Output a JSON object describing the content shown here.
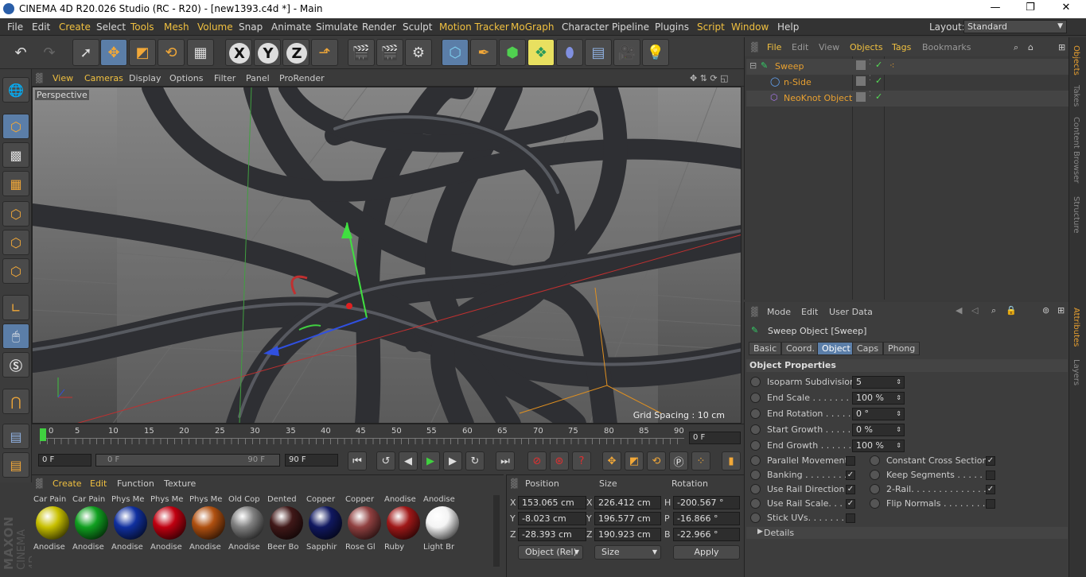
{
  "window": {
    "title": "CINEMA 4D R20.026 Studio (RC - R20) - [new1393.c4d *] - Main",
    "min": "—",
    "max": "❐",
    "close": "✕"
  },
  "menu": [
    "File",
    "Edit",
    "Create",
    "Select",
    "Tools",
    "Mesh",
    "Volume",
    "Snap",
    "Animate",
    "Simulate",
    "Render",
    "Sculpt",
    "Motion Tracker",
    "MoGraph",
    "Character",
    "Pipeline",
    "Plugins",
    "Script",
    "Window",
    "Help"
  ],
  "layout": {
    "label": "Layout:",
    "value": "Standard"
  },
  "toolbar_icons": [
    "undo-icon",
    "redo-icon",
    "select-cursor-icon",
    "move-icon",
    "scale-icon",
    "rotate-icon",
    "render-region-icon",
    "x-axis-icon",
    "y-axis-icon",
    "z-axis-icon",
    "coordinate-system-icon",
    "render-view-icon",
    "render-picture-viewer-icon",
    "edit-render-settings-icon",
    "cube-icon",
    "pen-spline-icon",
    "subdivision-icon",
    "array-icon",
    "deformer-icon",
    "floor-icon",
    "camera-icon",
    "light-icon"
  ],
  "viewport": {
    "menu": [
      "View",
      "Cameras",
      "Display",
      "Options",
      "Filter",
      "Panel",
      "ProRender"
    ],
    "label": "Perspective",
    "grid": "Grid Spacing : 10 cm"
  },
  "timeline": {
    "ticks": [
      "0",
      "5",
      "10",
      "15",
      "20",
      "25",
      "30",
      "35",
      "40",
      "45",
      "50",
      "55",
      "60",
      "65",
      "70",
      "75",
      "80",
      "85",
      "90"
    ],
    "frame": "0 F"
  },
  "playback": {
    "start": "0 F",
    "cur": "0 F",
    "end1": "90 F",
    "end2": "90 F"
  },
  "materials": {
    "tabs": [
      "Create",
      "Edit",
      "Function",
      "Texture"
    ],
    "items": [
      {
        "top": "Car Pain",
        "bottom": "Anodise",
        "color": "#c8c000"
      },
      {
        "top": "Car Pain",
        "bottom": "Anodise",
        "color": "#10a020"
      },
      {
        "top": "Phys Me",
        "bottom": "Anodise",
        "color": "#1030a0"
      },
      {
        "top": "Phys Me",
        "bottom": "Anodise",
        "color": "#c00010"
      },
      {
        "top": "Phys Me",
        "bottom": "Anodise",
        "color": "#b05010"
      },
      {
        "top": "Old Cop",
        "bottom": "Anodise",
        "color": "#808080"
      },
      {
        "top": "Dented",
        "bottom": "Beer Bo",
        "color": "#401818"
      },
      {
        "top": "Copper",
        "bottom": "Sapphir",
        "color": "#101860"
      },
      {
        "top": "Copper",
        "bottom": "Rose Gl",
        "color": "#904040"
      },
      {
        "top": "Anodise",
        "bottom": "Ruby",
        "color": "#a01818"
      },
      {
        "top": "Anodise",
        "bottom": "Light Br",
        "color": "#f4f4f4"
      }
    ]
  },
  "coords": {
    "headers": [
      "Position",
      "Size",
      "Rotation"
    ],
    "rows": [
      {
        "a": "X",
        "pos": "153.065 cm",
        "b": "X",
        "size": "226.412 cm",
        "c": "H",
        "rot": "-200.567 °"
      },
      {
        "a": "Y",
        "pos": "-8.023 cm",
        "b": "Y",
        "size": "196.577 cm",
        "c": "P",
        "rot": "-16.866 °"
      },
      {
        "a": "Z",
        "pos": "-28.393 cm",
        "b": "Z",
        "size": "190.923 cm",
        "c": "B",
        "rot": "-22.966 °"
      }
    ],
    "mode": "Object (Rel)",
    "size_mode": "Size",
    "apply": "Apply"
  },
  "objects": {
    "tabs": [
      "File",
      "Edit",
      "View",
      "Objects",
      "Tags",
      "Bookmarks"
    ],
    "tree": [
      {
        "name": "Sweep",
        "icon": "sweep-icon"
      },
      {
        "name": "n-Side",
        "icon": "nside-spline-icon"
      },
      {
        "name": "NeoKnot Object",
        "icon": "neoknot-icon"
      }
    ]
  },
  "attributes": {
    "menu": [
      "Mode",
      "Edit",
      "User Data"
    ],
    "title": "Sweep Object [Sweep]",
    "tabs": [
      "Basic",
      "Coord.",
      "Object",
      "Caps",
      "Phong"
    ],
    "section": "Object Properties",
    "props": [
      {
        "label": "Isoparm Subdivision",
        "value": "5"
      },
      {
        "label": "End Scale . . . . . . . . .",
        "value": "100 %"
      },
      {
        "label": "End Rotation . . . . . .",
        "value": "0 °"
      },
      {
        "label": "Start Growth . . . . . .",
        "value": "0 %"
      },
      {
        "label": "End Growth . . . . . . .",
        "value": "100 %"
      }
    ],
    "checks_left": [
      {
        "label": "Parallel Movement",
        "checked": ""
      },
      {
        "label": "Banking . . . . . . . .",
        "checked": "✓"
      },
      {
        "label": "Use Rail Direction",
        "checked": "✓"
      },
      {
        "label": "Use Rail Scale. . . .",
        "checked": "✓"
      },
      {
        "label": "Stick UVs. . . . . . . .",
        "checked": ""
      }
    ],
    "checks_right": [
      {
        "label": "Constant Cross Section",
        "checked": "✓"
      },
      {
        "label": "Keep Segments . . . . . .",
        "checked": ""
      },
      {
        "label": "2-Rail. . . . . . . . . . . . . .",
        "checked": "✓"
      },
      {
        "label": "Flip Normals . . . . . . . . .",
        "checked": ""
      }
    ],
    "details": "Details"
  },
  "side_tabs": [
    "Objects",
    "Takes",
    "Content Browser",
    "Structure",
    "Attributes",
    "Layers"
  ],
  "brand": {
    "maxon": "MAXON",
    "c4d": "CINEMA 4D"
  }
}
